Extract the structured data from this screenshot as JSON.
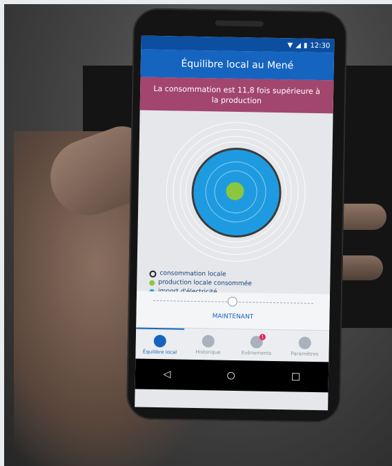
{
  "status": {
    "time": "12:30"
  },
  "app": {
    "title": "Équilibre local au Mené"
  },
  "banner": {
    "text": "La consommation est 11,8 fois supérieure à la production"
  },
  "legend": [
    {
      "label": "consommation locale",
      "color": "#222222"
    },
    {
      "label": "production locale consommée",
      "color": "#8cc63f"
    },
    {
      "label": "import d'électricité",
      "color": "#1e9be0"
    }
  ],
  "timeline": {
    "label": "MAINTENANT"
  },
  "tabs": [
    {
      "label": "Équilibre local",
      "icon": "target-icon"
    },
    {
      "label": "Historique",
      "icon": "history-icon"
    },
    {
      "label": "Evènements",
      "icon": "alert-icon",
      "badge": "1"
    },
    {
      "label": "Paramètres",
      "icon": "gear-icon"
    }
  ],
  "nav": {
    "back": "◁",
    "home": "○",
    "recents": "□"
  },
  "colors": {
    "appbar": "#1565c0",
    "banner": "#a2466e",
    "import": "#1e9be0",
    "production": "#8cc63f"
  }
}
